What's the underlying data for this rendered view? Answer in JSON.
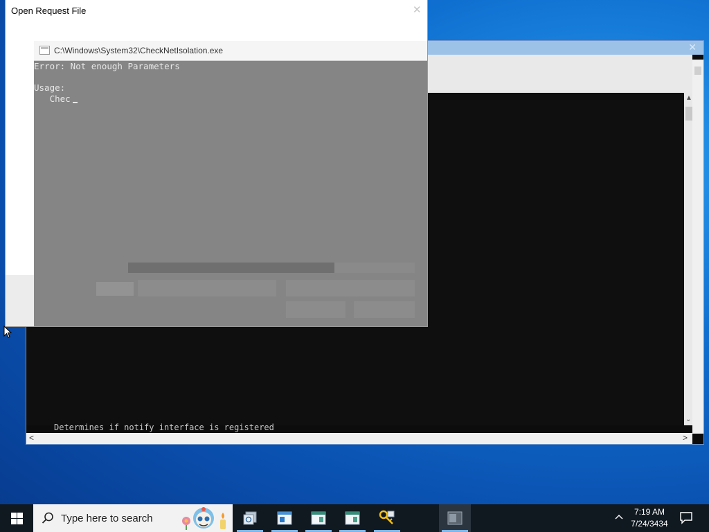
{
  "dialog": {
    "title": "Open Request File"
  },
  "front_console": {
    "path": "C:\\Windows\\System32\\CheckNetIsolation.exe",
    "lines": [
      "Error: Not enough Parameters",
      "",
      "Usage:",
      "   Chec"
    ]
  },
  "bg_console": {
    "bottom_text": "Determines if notify interface is registered"
  },
  "taskbar": {
    "search_placeholder": "Type here to search",
    "clock_time": "7:19 AM",
    "clock_date": "7/24/3434"
  },
  "colors": {
    "taskbar": "#101820",
    "accent": "#0f6fd0",
    "console_bg": "#0c0c0c"
  }
}
